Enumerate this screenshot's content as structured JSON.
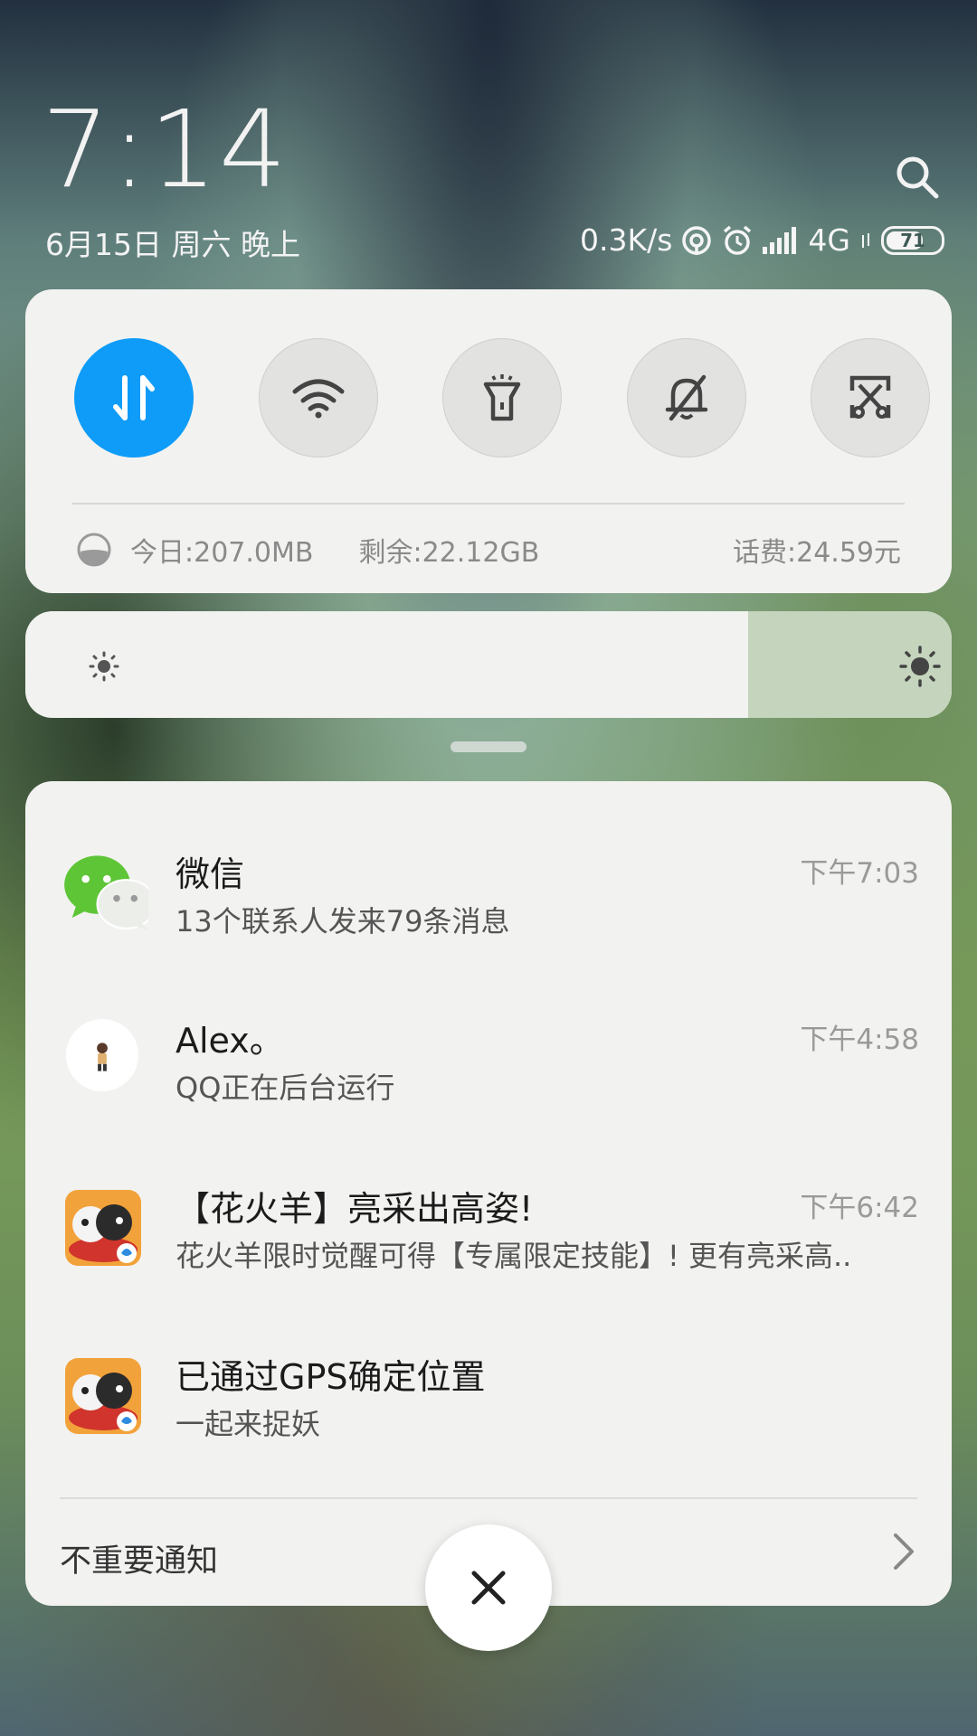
{
  "lockscreen": {
    "time": "7:14",
    "date": "6月15日 周六 晚上"
  },
  "status_bar": {
    "net_speed": "0.3K/s",
    "network_type": "4G",
    "battery_level": "71",
    "icons": [
      "hotspot-icon",
      "alarm-icon",
      "signal-icon",
      "data-arrows-icon",
      "battery-icon"
    ]
  },
  "quick_toggles": [
    {
      "name": "mobile-data",
      "icon": "data-transfer-icon",
      "active": true
    },
    {
      "name": "wifi",
      "icon": "wifi-icon",
      "active": false
    },
    {
      "name": "flashlight",
      "icon": "flashlight-icon",
      "active": false
    },
    {
      "name": "mute",
      "icon": "bell-off-icon",
      "active": false
    },
    {
      "name": "screenshot",
      "icon": "screenshot-scissors-icon",
      "active": false
    }
  ],
  "data_usage": {
    "today": "今日:207.0MB",
    "remaining": "剩余:22.12GB",
    "balance": "话费:24.59元"
  },
  "brightness": {
    "level_fraction": 0.78
  },
  "notifications": [
    {
      "app": "wechat",
      "title": "微信",
      "text": "13个联系人发来79条消息",
      "time": "下午7:03"
    },
    {
      "app": "qq",
      "title": "Alex。",
      "text": "QQ正在后台运行",
      "time": "下午4:58"
    },
    {
      "app": "game",
      "title": "【花火羊】亮采出高姿!",
      "text": "花火羊限时觉醒可得【专属限定技能】! 更有亮采高..",
      "time": "下午6:42"
    },
    {
      "app": "game",
      "title": "已通过GPS确定位置",
      "text": "一起来捉妖",
      "time": ""
    }
  ],
  "footer": {
    "unimportant_label": "不重要通知"
  },
  "colors": {
    "accent": "#0f9cf8",
    "card": "#f2f2f0"
  }
}
